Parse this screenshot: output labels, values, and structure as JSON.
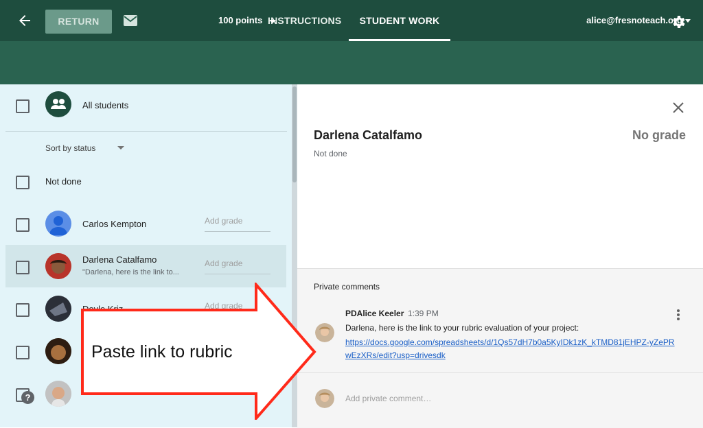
{
  "topbar": {
    "tabs": [
      {
        "label": "INSTRUCTIONS"
      },
      {
        "label": "STUDENT WORK"
      }
    ],
    "account": "alice@fresnoteach.org"
  },
  "toolbar": {
    "return_label": "RETURN",
    "points_label": "100 points"
  },
  "roster": {
    "all_students_label": "All students",
    "sort_label": "Sort by status",
    "group_label": "Not done",
    "students": [
      {
        "name": "Carlos Kempton",
        "grade_placeholder": "Add grade",
        "preview": ""
      },
      {
        "name": "Darlena Catalfamo",
        "grade_placeholder": "Add grade",
        "preview": "\"Darlena, here is the link to..."
      },
      {
        "name": "Doyle Kriz",
        "grade_placeholder": "Add grade",
        "preview": ""
      }
    ],
    "help_glyph": "?"
  },
  "detail": {
    "student_name": "Darlena Catalfamo",
    "grade_status": "No grade",
    "status": "Not done",
    "comments_heading": "Private comments",
    "comment": {
      "author": "PDAlice Keeler",
      "time": "1:39 PM",
      "text": "Darlena, here is the link to your rubric evaluation of your project:",
      "link": "https://docs.google.com/spreadsheets/d/1Qs57dH7b0a5KyIDk1zK_kTMD81jEHPZ-yZePRwEzXRs/edit?usp=drivesdk"
    },
    "compose_placeholder": "Add private comment…"
  },
  "callout": {
    "text": "Paste link to rubric",
    "stroke_color": "#ff2a1a"
  },
  "colors": {
    "topbar": "#1e4d3e",
    "toolbar": "#2a6350",
    "roster_bg": "#e3f4f9",
    "link": "#1a5fc7"
  }
}
